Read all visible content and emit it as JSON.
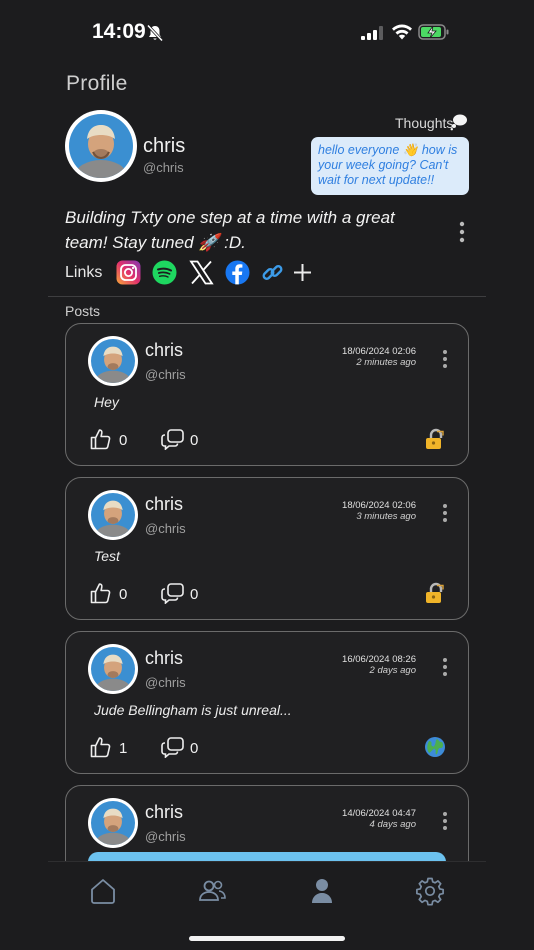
{
  "status_bar": {
    "time": "14:09"
  },
  "header": {
    "title": "Profile"
  },
  "profile": {
    "name": "chris",
    "handle": "@chris",
    "thoughts_label": "Thoughts",
    "thought": "hello everyone 👋 how is your week going? Can't wait for next update!!",
    "bio": "Building Txty one step at a time with a great team! Stay tuned 🚀 :D.",
    "links_label": "Links",
    "links": [
      "instagram",
      "spotify",
      "x",
      "facebook",
      "link",
      "add"
    ]
  },
  "posts_label": "Posts",
  "posts": [
    {
      "name": "chris",
      "handle": "@chris",
      "date": "18/06/2024 02:06",
      "ago": "2 minutes ago",
      "text": "Hey",
      "likes": "0",
      "comments": "0",
      "visibility": "private-lock-icon"
    },
    {
      "name": "chris",
      "handle": "@chris",
      "date": "18/06/2024 02:06",
      "ago": "3 minutes ago",
      "text": "Test",
      "likes": "0",
      "comments": "0",
      "visibility": "private-lock-icon"
    },
    {
      "name": "chris",
      "handle": "@chris",
      "date": "16/06/2024 08:26",
      "ago": "2 days ago",
      "text": "Jude Bellingham is just unreal...",
      "likes": "1",
      "comments": "0",
      "visibility": "public-globe-icon"
    },
    {
      "name": "chris",
      "handle": "@chris",
      "date": "14/06/2024 04:47",
      "ago": "4 days ago",
      "text": "",
      "likes": "",
      "comments": "",
      "visibility": ""
    }
  ],
  "tabbar": {
    "items": [
      "home-icon",
      "friends-icon",
      "profile-icon",
      "settings-icon"
    ],
    "active": "profile-icon"
  },
  "colors": {
    "background": "#1c1c1e",
    "thought_bubble": "#dcebfa",
    "thought_text": "#2f7fe0",
    "card_border": "#6b6b6b"
  }
}
